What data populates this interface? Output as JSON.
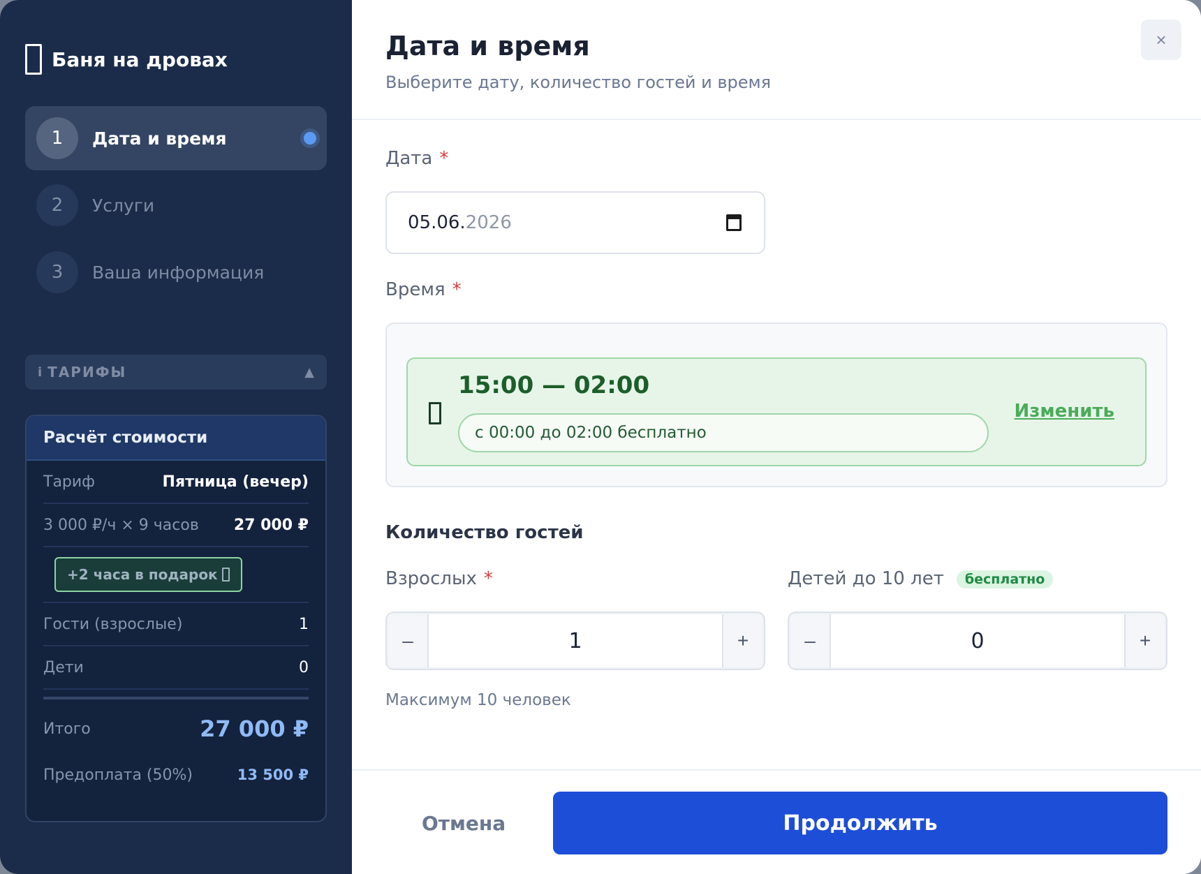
{
  "sidebar": {
    "brand_title": "Баня на дровах",
    "steps": [
      {
        "num": "1",
        "label": "Дата и время",
        "active": true
      },
      {
        "num": "2",
        "label": "Услуги",
        "active": false
      },
      {
        "num": "3",
        "label": "Ваша информация",
        "active": false
      }
    ],
    "tariffs": {
      "info_glyph": "i",
      "label": "ТАРИФЫ",
      "toggle_glyph": "▲"
    },
    "calc": {
      "title": "Расчёт стоимости",
      "tariff_label": "Тариф",
      "tariff_value": "Пятница (вечер)",
      "rate_label": "3 000 ₽/ч × 9 часов",
      "rate_value": "27 000 ₽",
      "gift": "+2 часа в подарок",
      "guests_label": "Гости (взрослые)",
      "guests_value": "1",
      "children_label": "Дети",
      "children_value": "0",
      "total_label": "Итого",
      "total_value": "27 000 ₽",
      "prepay_label": "Предоплата (50%)",
      "prepay_value": "13 500 ₽"
    }
  },
  "main": {
    "title": "Дата и время",
    "subtitle": "Выберите дату, количество гостей и время",
    "close_glyph": "×",
    "date": {
      "label": "Дата",
      "required_mark": "*",
      "value_day_month": "05.06.",
      "value_year": "2026"
    },
    "time": {
      "label": "Время",
      "required_mark": "*",
      "slot": "15:00 — 02:00",
      "slot_note": "с 00:00 до 02:00 бесплатно",
      "change_link": "Изменить"
    },
    "guests": {
      "title": "Количество гостей",
      "adults_label": "Взрослых",
      "required_mark": "*",
      "adults_value": "1",
      "children_label": "Детей до 10 лет",
      "children_badge": "бесплатно",
      "children_value": "0",
      "minus_glyph": "–",
      "plus_glyph": "+",
      "max_note": "Максимум 10 человек"
    },
    "footer": {
      "cancel": "Отмена",
      "continue": "Продолжить"
    }
  },
  "colors": {
    "sidebar_bg": "#1b2c4a",
    "accent": "#1d4ed8",
    "slot_green": "#e7f5e9",
    "total_blue": "#8fbaf6"
  },
  "icons": {
    "brand": "door-icon",
    "slot": "door-icon",
    "gift": "door-icon",
    "date": "calendar-icon",
    "close": "close-icon"
  }
}
